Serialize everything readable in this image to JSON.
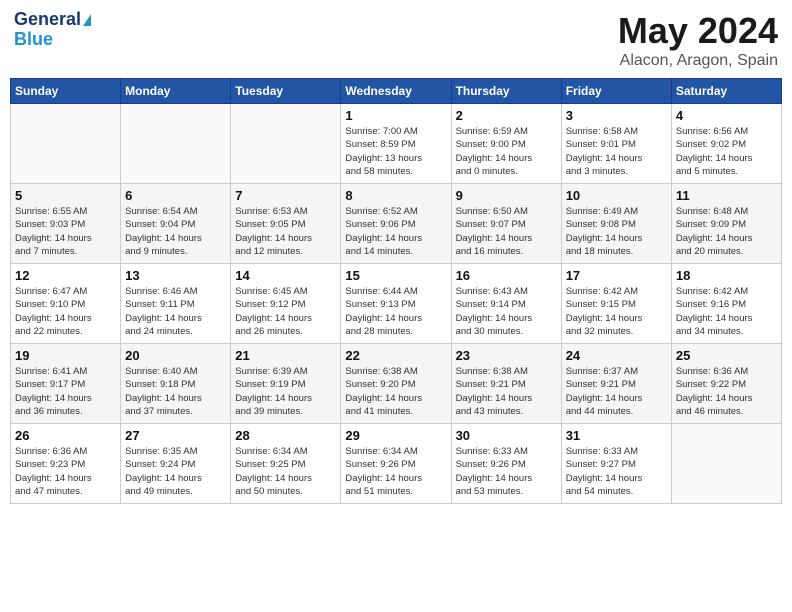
{
  "header": {
    "logo_line1": "General",
    "logo_line2": "Blue",
    "title": "May 2024",
    "location": "Alacon, Aragon, Spain"
  },
  "weekdays": [
    "Sunday",
    "Monday",
    "Tuesday",
    "Wednesday",
    "Thursday",
    "Friday",
    "Saturday"
  ],
  "weeks": [
    [
      {
        "day": "",
        "info": ""
      },
      {
        "day": "",
        "info": ""
      },
      {
        "day": "",
        "info": ""
      },
      {
        "day": "1",
        "info": "Sunrise: 7:00 AM\nSunset: 8:59 PM\nDaylight: 13 hours\nand 58 minutes."
      },
      {
        "day": "2",
        "info": "Sunrise: 6:59 AM\nSunset: 9:00 PM\nDaylight: 14 hours\nand 0 minutes."
      },
      {
        "day": "3",
        "info": "Sunrise: 6:58 AM\nSunset: 9:01 PM\nDaylight: 14 hours\nand 3 minutes."
      },
      {
        "day": "4",
        "info": "Sunrise: 6:56 AM\nSunset: 9:02 PM\nDaylight: 14 hours\nand 5 minutes."
      }
    ],
    [
      {
        "day": "5",
        "info": "Sunrise: 6:55 AM\nSunset: 9:03 PM\nDaylight: 14 hours\nand 7 minutes."
      },
      {
        "day": "6",
        "info": "Sunrise: 6:54 AM\nSunset: 9:04 PM\nDaylight: 14 hours\nand 9 minutes."
      },
      {
        "day": "7",
        "info": "Sunrise: 6:53 AM\nSunset: 9:05 PM\nDaylight: 14 hours\nand 12 minutes."
      },
      {
        "day": "8",
        "info": "Sunrise: 6:52 AM\nSunset: 9:06 PM\nDaylight: 14 hours\nand 14 minutes."
      },
      {
        "day": "9",
        "info": "Sunrise: 6:50 AM\nSunset: 9:07 PM\nDaylight: 14 hours\nand 16 minutes."
      },
      {
        "day": "10",
        "info": "Sunrise: 6:49 AM\nSunset: 9:08 PM\nDaylight: 14 hours\nand 18 minutes."
      },
      {
        "day": "11",
        "info": "Sunrise: 6:48 AM\nSunset: 9:09 PM\nDaylight: 14 hours\nand 20 minutes."
      }
    ],
    [
      {
        "day": "12",
        "info": "Sunrise: 6:47 AM\nSunset: 9:10 PM\nDaylight: 14 hours\nand 22 minutes."
      },
      {
        "day": "13",
        "info": "Sunrise: 6:46 AM\nSunset: 9:11 PM\nDaylight: 14 hours\nand 24 minutes."
      },
      {
        "day": "14",
        "info": "Sunrise: 6:45 AM\nSunset: 9:12 PM\nDaylight: 14 hours\nand 26 minutes."
      },
      {
        "day": "15",
        "info": "Sunrise: 6:44 AM\nSunset: 9:13 PM\nDaylight: 14 hours\nand 28 minutes."
      },
      {
        "day": "16",
        "info": "Sunrise: 6:43 AM\nSunset: 9:14 PM\nDaylight: 14 hours\nand 30 minutes."
      },
      {
        "day": "17",
        "info": "Sunrise: 6:42 AM\nSunset: 9:15 PM\nDaylight: 14 hours\nand 32 minutes."
      },
      {
        "day": "18",
        "info": "Sunrise: 6:42 AM\nSunset: 9:16 PM\nDaylight: 14 hours\nand 34 minutes."
      }
    ],
    [
      {
        "day": "19",
        "info": "Sunrise: 6:41 AM\nSunset: 9:17 PM\nDaylight: 14 hours\nand 36 minutes."
      },
      {
        "day": "20",
        "info": "Sunrise: 6:40 AM\nSunset: 9:18 PM\nDaylight: 14 hours\nand 37 minutes."
      },
      {
        "day": "21",
        "info": "Sunrise: 6:39 AM\nSunset: 9:19 PM\nDaylight: 14 hours\nand 39 minutes."
      },
      {
        "day": "22",
        "info": "Sunrise: 6:38 AM\nSunset: 9:20 PM\nDaylight: 14 hours\nand 41 minutes."
      },
      {
        "day": "23",
        "info": "Sunrise: 6:38 AM\nSunset: 9:21 PM\nDaylight: 14 hours\nand 43 minutes."
      },
      {
        "day": "24",
        "info": "Sunrise: 6:37 AM\nSunset: 9:21 PM\nDaylight: 14 hours\nand 44 minutes."
      },
      {
        "day": "25",
        "info": "Sunrise: 6:36 AM\nSunset: 9:22 PM\nDaylight: 14 hours\nand 46 minutes."
      }
    ],
    [
      {
        "day": "26",
        "info": "Sunrise: 6:36 AM\nSunset: 9:23 PM\nDaylight: 14 hours\nand 47 minutes."
      },
      {
        "day": "27",
        "info": "Sunrise: 6:35 AM\nSunset: 9:24 PM\nDaylight: 14 hours\nand 49 minutes."
      },
      {
        "day": "28",
        "info": "Sunrise: 6:34 AM\nSunset: 9:25 PM\nDaylight: 14 hours\nand 50 minutes."
      },
      {
        "day": "29",
        "info": "Sunrise: 6:34 AM\nSunset: 9:26 PM\nDaylight: 14 hours\nand 51 minutes."
      },
      {
        "day": "30",
        "info": "Sunrise: 6:33 AM\nSunset: 9:26 PM\nDaylight: 14 hours\nand 53 minutes."
      },
      {
        "day": "31",
        "info": "Sunrise: 6:33 AM\nSunset: 9:27 PM\nDaylight: 14 hours\nand 54 minutes."
      },
      {
        "day": "",
        "info": ""
      }
    ]
  ]
}
